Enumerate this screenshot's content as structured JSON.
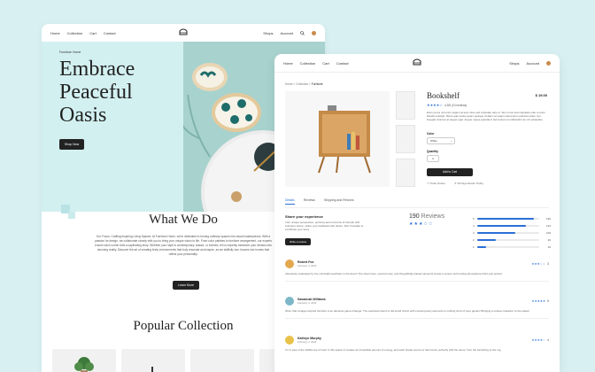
{
  "nav": {
    "links": [
      "Home",
      "Collection",
      "Cart",
      "Contact"
    ],
    "shops": "Shops",
    "account": "Account"
  },
  "hero": {
    "small_label": "Furniture Home",
    "title_lines": [
      "Embrace",
      "Peaceful",
      "Oasis"
    ],
    "button": "Shop Now"
  },
  "what_we_do": {
    "title": "What We Do",
    "text": "Our Focus: Crafting Inspiring Living Spaces. At Furniture Home, we're dedicated to turning ordinary spaces into visual masterpieces. With a passion for design, we collaborate closely with you to bring your unique vision to life. From color palettes to furniture arrangement, our experts ensure each corner tells a captivating story. Whether your style is contemporary, classic, or eclectic, let us expertly transform your dreams into stunning reality. Discover the art of creating lively environments that truly resonate and inspire, as we skillfully turn houses into homes that reflect your personality.",
    "button": "Learn More"
  },
  "popular": {
    "title": "Popular Collection"
  },
  "product": {
    "breadcrumb": [
      "Home",
      "Collection",
      "Furniture"
    ],
    "title": "Bookshelf",
    "price": "$ 19.00",
    "rating_text": "4.3/5 (10 reviews)",
    "description": "Enim purus nisl enim sapien at quis risus sed vulputate odio ut. Sum risus sed vulputate odio ut enim blandit volutpat. Risus quis varius quam quisque id diam vel quam elementum pulvinar etiam non. Feugiat vivamus at augue eget. Augue neque gravida in fermentum et sollicitudin ac orci phasellus.",
    "color_label": "Color",
    "color_value": "White",
    "quantity_label": "Quantity",
    "quantity_value": "1",
    "add_to_cart": "Add to Cart",
    "meta": [
      "Track Orders",
      "30 Days Return Policy"
    ]
  },
  "tabs": [
    "Details",
    "Reviews",
    "Shipping and Returns"
  ],
  "share": {
    "title": "Share your experience",
    "text": "Your unique perspective, opinions and moments of triumph with Furniture Home, share your feedback with others. Don't hesitate to contribute your story.",
    "button": "Write a review"
  },
  "reviews_summary": {
    "count": "190",
    "label": "Reviews",
    "stars": "★★★☆☆",
    "bars": [
      {
        "star": "5",
        "fraction": 0.92,
        "count": "190"
      },
      {
        "star": "4",
        "fraction": 0.78,
        "count": "134"
      },
      {
        "star": "3",
        "fraction": 0.62,
        "count": "100"
      },
      {
        "star": "2",
        "fraction": 0.3,
        "count": "20"
      },
      {
        "star": "1",
        "fraction": 0.14,
        "count": "10"
      }
    ]
  },
  "reviews": [
    {
      "name": "Robert Fox",
      "date": "February 4, 2023",
      "stars": "★★★☆☆",
      "score": "3",
      "text": "Absolutely captivated by the minimalist aesthetic in the decor! The clean lines, neutral tones, and thoughtfully placed elements create a serene and inviting atmosphere that's just perfect."
    },
    {
      "name": "Savannah Williams",
      "date": "February 4, 2023",
      "stars": "★★★★★",
      "score": "5",
      "text": "Wow, that vintage-inspired furniture is an absolute game-changer. The seamless blend of old-world charm with contemporary elements is nothing short of pure genius! Bringing a unique character to the space!"
    },
    {
      "name": "Kathryn Murphy",
      "date": "February 4, 2023",
      "stars": "★★★★☆",
      "score": "4",
      "text": "I'm in awe of the skillful use of color in this space! It creates an irresistible amount of energy, and each shade seems to harmonize perfectly with the decor, from the furnishing to the rug."
    }
  ]
}
